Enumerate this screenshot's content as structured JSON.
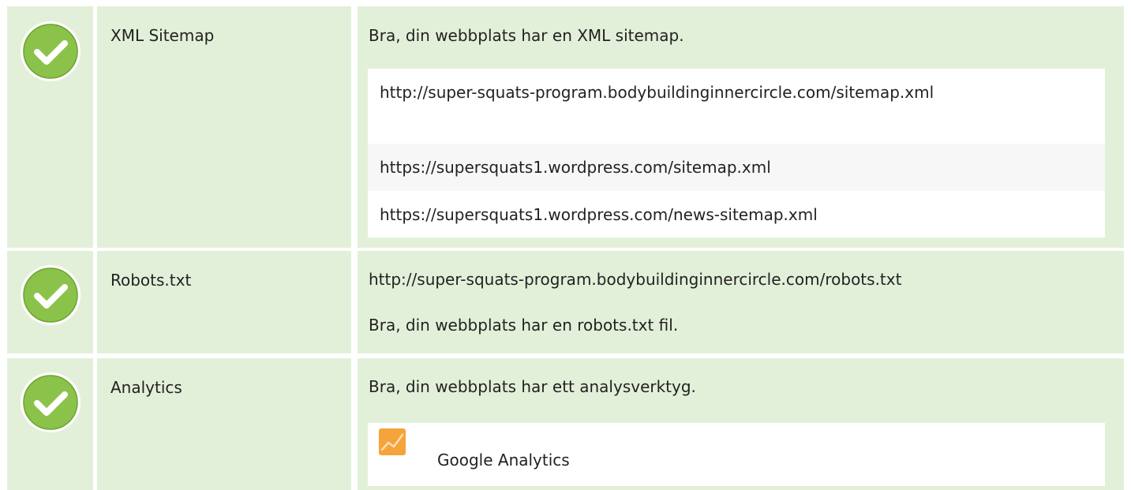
{
  "sections": [
    {
      "label": "XML Sitemap",
      "status": "check-circle-icon",
      "message": "Bra, din webbplats har en XML sitemap.",
      "items": [
        "http://super-squats-program.bodybuildinginnercircle.com/sitemap.xml",
        "https://supersquats1.wordpress.com/sitemap.xml",
        "https://supersquats1.wordpress.com/news-sitemap.xml"
      ]
    },
    {
      "label": "Robots.txt",
      "status": "check-circle-icon",
      "url": "http://super-squats-program.bodybuildinginnercircle.com/robots.txt",
      "message": "Bra, din webbplats har en robots.txt fil."
    },
    {
      "label": "Analytics",
      "status": "check-circle-icon",
      "message": "Bra, din webbplats har ett analysverktyg.",
      "tools": [
        {
          "name": "Google Analytics",
          "icon": "google-analytics-icon"
        }
      ]
    }
  ],
  "colors": {
    "row_background": "#e3f0d9",
    "check_green": "#8bc34a",
    "list_alt_row": "#f7f7f7",
    "analytics_orange": "#f4a43a"
  }
}
